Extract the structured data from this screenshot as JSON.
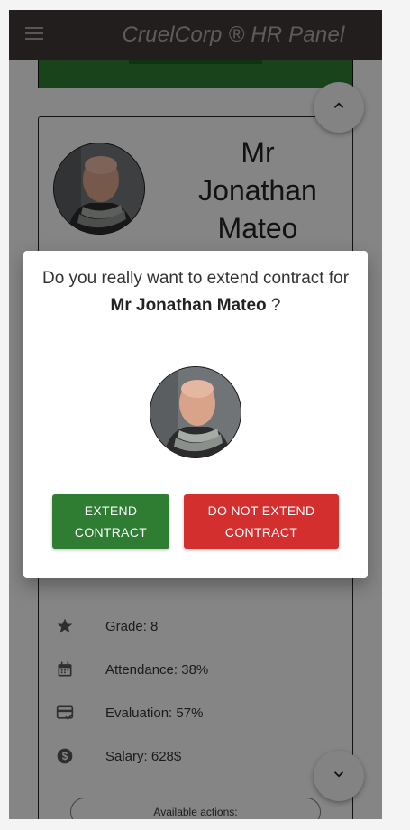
{
  "app": {
    "title": "CruelCorp ® HR Panel"
  },
  "employee": {
    "name_lines": [
      "Mr",
      "Jonathan",
      "Mateo"
    ],
    "full_name": "Mr Jonathan Mateo"
  },
  "stats": [
    {
      "icon": "star-icon",
      "text": "Grade: 8"
    },
    {
      "icon": "calendar-icon",
      "text": "Attendance: 38%"
    },
    {
      "icon": "card-check-icon",
      "text": "Evaluation: 57%"
    },
    {
      "icon": "dollar-icon",
      "text": "Salary: 628$"
    }
  ],
  "actions_label": "Available actions:",
  "dialog": {
    "text_before": "Do you really want to extend contract for",
    "text_after": " ?",
    "extend_label_1": "EXTEND",
    "extend_label_2": "CONTRACT",
    "noextend_label_1": "DO NOT EXTEND",
    "noextend_label_2": "CONTRACT"
  },
  "colors": {
    "appbar": "#3d3835",
    "extend": "#2e7d32",
    "noextend": "#d32f2f"
  }
}
